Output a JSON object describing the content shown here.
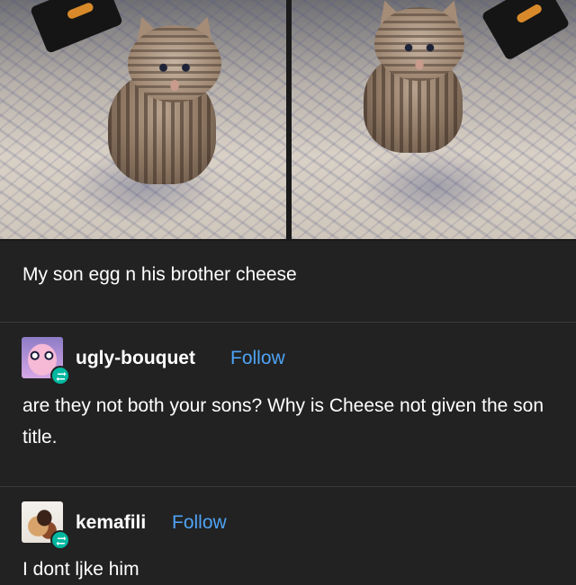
{
  "post": {
    "caption": "My son egg n his brother cheese",
    "images": [
      {
        "name": "kitten-photo-egg"
      },
      {
        "name": "kitten-photo-cheese"
      }
    ]
  },
  "reblogs": [
    {
      "username": "ugly-bouquet",
      "follow_label": "Follow",
      "text": "are they not both your sons? Why is Cheese not given the son title.",
      "avatar_icon": "pink-puffball-avatar",
      "badge_icon": "reblog-icon"
    },
    {
      "username": "kemafili",
      "follow_label": "Follow",
      "text": "I dont ljke him",
      "avatar_icon": "fox-character-avatar",
      "badge_icon": "reblog-icon"
    }
  ],
  "colors": {
    "background": "#222222",
    "text": "#ffffff",
    "follow": "#4ea3f5",
    "reblog_badge": "#00b8a0",
    "divider": "#3a3a3a"
  }
}
